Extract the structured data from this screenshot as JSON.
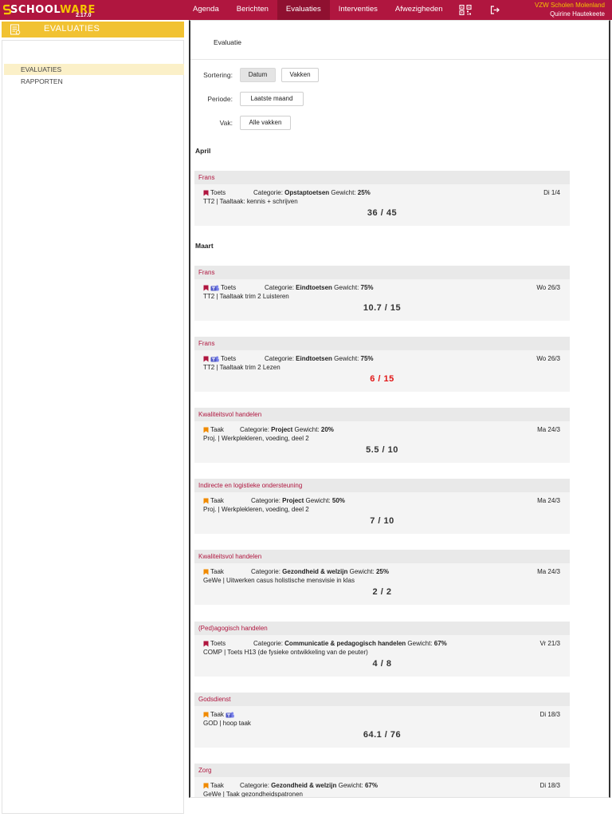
{
  "header": {
    "logo_text_a": "SCHOOL",
    "logo_text_b": "WARE",
    "version": "2.17.0",
    "nav": [
      {
        "label": "Agenda",
        "active": false
      },
      {
        "label": "Berichten",
        "active": false
      },
      {
        "label": "Evaluaties",
        "active": true
      },
      {
        "label": "Interventies",
        "active": false
      },
      {
        "label": "Afwezigheden",
        "active": false
      }
    ],
    "icons": [
      "qr-code-icon",
      "logout-icon"
    ],
    "school_name": "VZW Scholen Molenland",
    "user_name": "Quirine Hautekeete"
  },
  "sidebar": {
    "title": "EVALUATIES",
    "items": [
      {
        "label": "EVALUATIES",
        "active": true
      },
      {
        "label": "RAPPORTEN",
        "active": false
      }
    ]
  },
  "main": {
    "breadcrumb": "Evaluatie",
    "filters": {
      "sort_label": "Sortering:",
      "sort_options": [
        {
          "label": "Datum",
          "active": true
        },
        {
          "label": "Vakken",
          "active": false
        }
      ],
      "period_label": "Periode:",
      "period_value": "Laatste maand",
      "subject_label": "Vak:",
      "subject_value": "Alle vakken"
    },
    "months": [
      "April",
      "Maart"
    ],
    "cards": [
      {
        "subject": "Frans",
        "flag": "red",
        "teams": false,
        "type": "Toets",
        "teams_after": false,
        "cat_label": "Categorie:",
        "category": "Opstaptoetsen",
        "weight_label": "Gewicht:",
        "weight": "25%",
        "date": "Di 1/4",
        "description": "TT2 | Taaltaak: kennis + schrijven",
        "score": "36 / 45",
        "fail": false
      },
      {
        "subject": "Frans",
        "flag": "red",
        "teams": true,
        "type": "Toets",
        "teams_after": false,
        "cat_label": "Categorie:",
        "category": "Eindtoetsen",
        "weight_label": "Gewicht:",
        "weight": "75%",
        "date": "Wo 26/3",
        "description": "TT2 | Taaltaak trim 2 Luisteren",
        "score": "10.7 / 15",
        "fail": false
      },
      {
        "subject": "Frans",
        "flag": "red",
        "teams": true,
        "type": "Toets",
        "teams_after": false,
        "cat_label": "Categorie:",
        "category": "Eindtoetsen",
        "weight_label": "Gewicht:",
        "weight": "75%",
        "date": "Wo 26/3",
        "description": "TT2 | Taaltaak trim 2 Lezen",
        "score": "6 / 15",
        "fail": true
      },
      {
        "subject": "Kwaliteitsvol handelen",
        "flag": "orange",
        "teams": false,
        "type": "Taak",
        "teams_after": false,
        "cat_label": "Categorie:",
        "category": "Project",
        "weight_label": "Gewicht:",
        "weight": "20%",
        "date": "Ma 24/3",
        "description": "Proj. | Werkplekleren, voeding, deel 2",
        "score": "5.5 / 10",
        "fail": false
      },
      {
        "subject": "Indirecte en logistieke ondersteuning",
        "flag": "orange",
        "teams": false,
        "type": "Taak",
        "teams_after": false,
        "cat_label": "Categorie:",
        "category": "Project",
        "weight_label": "Gewicht:",
        "weight": "50%",
        "date": "Ma 24/3",
        "description": "Proj. | Werkplekleren, voeding, deel 2",
        "score": "7 / 10",
        "fail": false
      },
      {
        "subject": "Kwaliteitsvol handelen",
        "flag": "orange",
        "teams": false,
        "type": "Taak",
        "teams_after": false,
        "cat_label": "Categorie:",
        "category": "Gezondheid & welzijn",
        "weight_label": "Gewicht:",
        "weight": "25%",
        "date": "Ma 24/3",
        "description": "GeWe | Uitwerken casus holistische mensvisie in klas",
        "score": "2 / 2",
        "fail": false
      },
      {
        "subject": "(Ped)agogisch handelen",
        "flag": "red",
        "teams": false,
        "type": "Toets",
        "teams_after": false,
        "cat_label": "Categorie:",
        "category": "Communicatie & pedagogisch handelen",
        "weight_label": "Gewicht:",
        "weight": "67%",
        "date": "Vr 21/3",
        "description": "COMP | Toets H13 (de fysieke ontwikkeling van de peuter)",
        "score": "4 / 8",
        "fail": false
      },
      {
        "subject": "Godsdienst",
        "flag": "orange",
        "teams": true,
        "type": "Taak",
        "teams_after": true,
        "cat_label": "",
        "category": "",
        "weight_label": "",
        "weight": "",
        "date": "Di 18/3",
        "description": "GOD | hoop taak",
        "score": "64.1 / 76",
        "fail": false
      },
      {
        "subject": "Zorg",
        "flag": "orange",
        "teams": false,
        "type": "Taak",
        "teams_after": false,
        "cat_label": "Categorie:",
        "category": "Gezondheid & welzijn",
        "weight_label": "Gewicht:",
        "weight": "67%",
        "date": "Di 18/3",
        "description": "GeWe | Taak gezondheidspatronen",
        "score": "",
        "fail": false
      }
    ]
  },
  "colors": {
    "brand": "#b0163f",
    "accent": "#f1c232",
    "flag_red": "#b0163f",
    "flag_orange": "#f08a00",
    "teams": "#5059c9",
    "fail": "#e11414"
  }
}
